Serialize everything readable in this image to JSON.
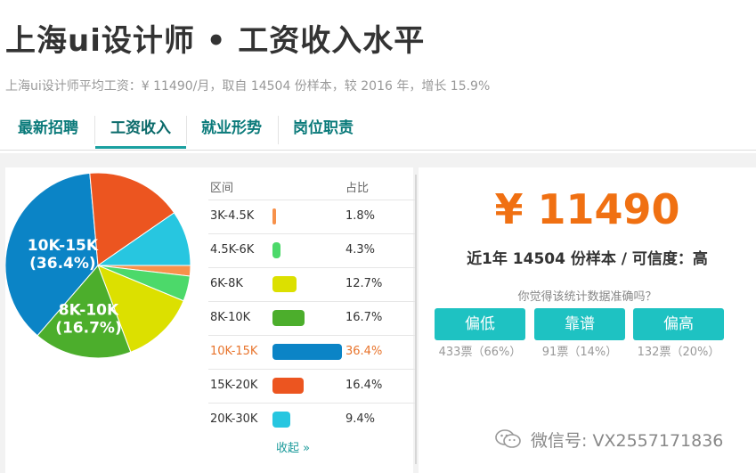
{
  "header": {
    "title": "上海ui设计师 • 工资收入水平",
    "subtitle": "上海ui设计师平均工资：¥ 11490/月，取自 14504 份样本，较 2016 年，增长 15.9%"
  },
  "tabs": [
    {
      "label": "最新招聘",
      "active": false
    },
    {
      "label": "工资收入",
      "active": true
    },
    {
      "label": "就业形势",
      "active": false
    },
    {
      "label": "岗位职责",
      "active": false
    }
  ],
  "chart_data": {
    "type": "pie",
    "categories": [
      "3K-4.5K",
      "4.5K-6K",
      "6K-8K",
      "8K-10K",
      "10K-15K",
      "15K-20K",
      "20K-30K"
    ],
    "values": [
      1.8,
      4.3,
      12.7,
      16.7,
      36.4,
      16.4,
      9.4
    ],
    "colors": [
      "#f7914a",
      "#4cd96a",
      "#dce000",
      "#4cae2c",
      "#0b84c6",
      "#ec5520",
      "#27c6e0"
    ],
    "slice_labels": [
      {
        "category": "10K-15K",
        "name": "10K-15K",
        "value": "(36.4%)"
      },
      {
        "category": "8K-10K",
        "name": "8K-10K",
        "value": "(16.7%)"
      }
    ]
  },
  "table": {
    "headers": {
      "range": "区间",
      "share": "占比"
    },
    "rows": [
      {
        "range": "3K-4.5K",
        "pct": "1.8%",
        "value": 1.8,
        "color": "#f7914a",
        "highlight": false
      },
      {
        "range": "4.5K-6K",
        "pct": "4.3%",
        "value": 4.3,
        "color": "#4cd96a",
        "highlight": false
      },
      {
        "range": "6K-8K",
        "pct": "12.7%",
        "value": 12.7,
        "color": "#dce000",
        "highlight": false
      },
      {
        "range": "8K-10K",
        "pct": "16.7%",
        "value": 16.7,
        "color": "#4cae2c",
        "highlight": false
      },
      {
        "range": "10K-15K",
        "pct": "36.4%",
        "value": 36.4,
        "color": "#0b84c6",
        "highlight": true
      },
      {
        "range": "15K-20K",
        "pct": "16.4%",
        "value": 16.4,
        "color": "#ec5520",
        "highlight": false
      },
      {
        "range": "20K-30K",
        "pct": "9.4%",
        "value": 9.4,
        "color": "#27c6e0",
        "highlight": false
      }
    ],
    "collapse_label": "收起 »"
  },
  "summary": {
    "salary": "¥ 11490",
    "samples": "近1年 14504 份样本 / 可信度：高",
    "question": "你觉得该统计数据准确吗？",
    "vote_buttons": [
      {
        "label": "偏低",
        "count": "433票（66%）"
      },
      {
        "label": "靠谱",
        "count": "91票（14%）"
      },
      {
        "label": "偏高",
        "count": "132票（20%）"
      }
    ]
  },
  "watermark": {
    "text": "微信号: VX2557171836",
    "icon": "wechat-icon"
  },
  "colors": {
    "accent": "#1ec2c2",
    "salary": "#f07012",
    "tab_text": "#0a7a7a"
  }
}
